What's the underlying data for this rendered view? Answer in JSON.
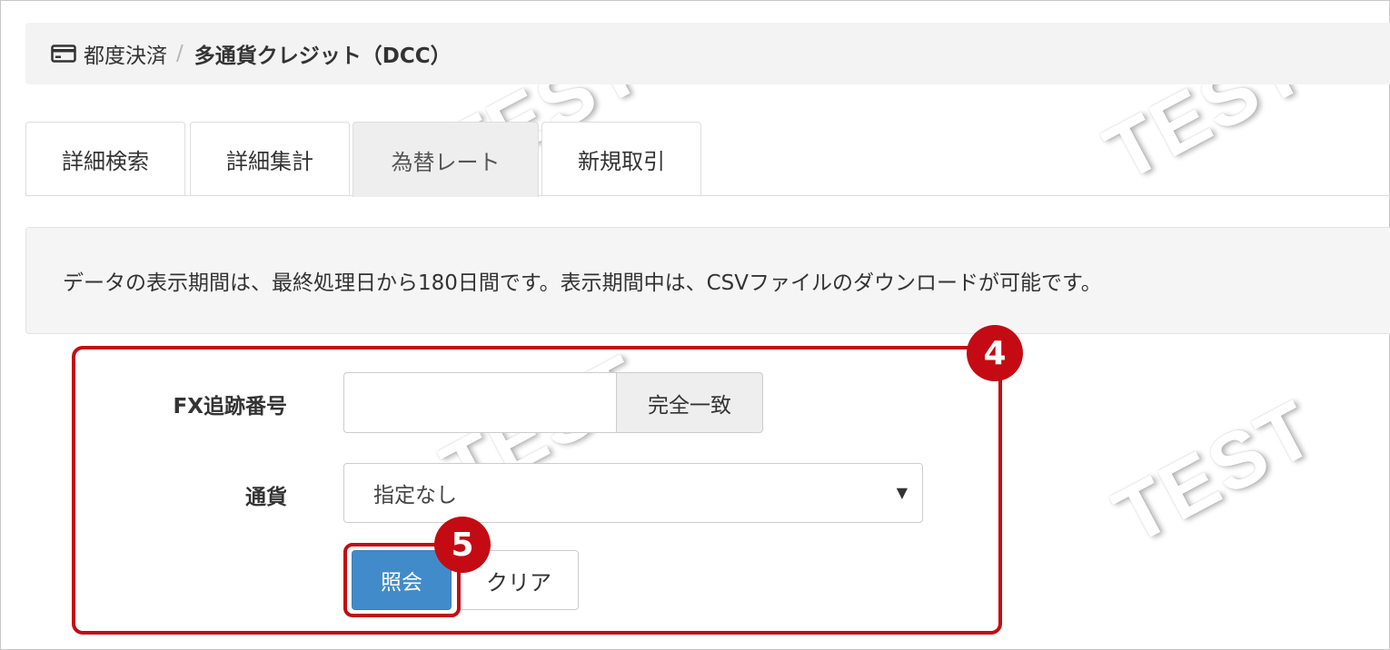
{
  "breadcrumb": {
    "icon": "credit-card-icon",
    "parent": "都度決済",
    "separator": "/",
    "current": "多通貨クレジット（DCC）"
  },
  "tabs": [
    {
      "label": "詳細検索",
      "active": false
    },
    {
      "label": "詳細集計",
      "active": false
    },
    {
      "label": "為替レート",
      "active": true
    },
    {
      "label": "新規取引",
      "active": false
    }
  ],
  "notice": {
    "text": "データの表示期間は、最終処理日から180日間です。表示期間中は、CSVファイルのダウンロードが可能です。"
  },
  "form": {
    "fx_label": "FX追跡番号",
    "fx_value": "",
    "fx_match_label": "完全一致",
    "currency_label": "通貨",
    "currency_selected": "指定なし",
    "search_button": "照会",
    "clear_button": "クリア"
  },
  "annotations": {
    "badge_form": "4",
    "badge_search": "5",
    "color": "#c40b13"
  },
  "watermark": "TEST",
  "colors": {
    "primary_button": "#428bca",
    "highlight": "#c40b13"
  }
}
